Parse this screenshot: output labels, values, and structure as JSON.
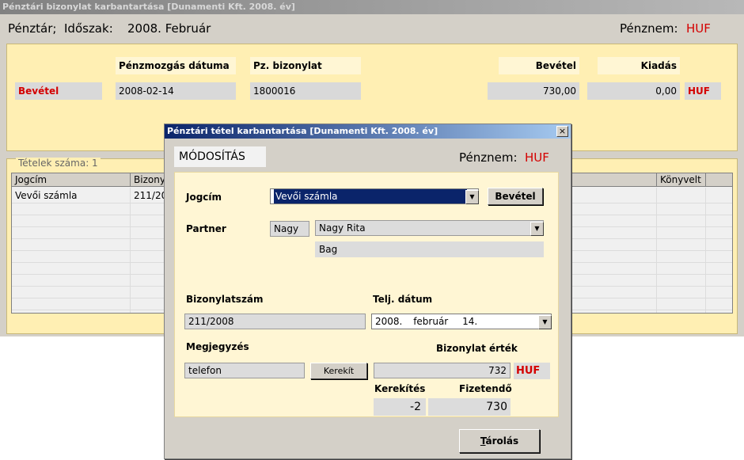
{
  "main": {
    "title": "Pénztári bizonylat karbantartása  [Dunamenti Kft.  2008. év]",
    "penztar_label": "Pénztár;",
    "idoszak_label": "Időszak:",
    "idoszak_value": "2008.  Február",
    "penznem_label": "Pénznem:",
    "penznem_value": "HUF",
    "cols": {
      "datum": "Pénzmozgás dátuma",
      "bizonylat": "Pz. bizonylat",
      "bevetel": "Bevétel",
      "kiadas": "Kiadás"
    },
    "row": {
      "type": "Bevétel",
      "datum": "2008-02-14",
      "bizonylat": "1800016",
      "bevetel": "730,00",
      "kiadas": "0,00",
      "currency": "HUF"
    },
    "grid": {
      "legend": "Tételek száma: 1",
      "headers": [
        "Jogcím",
        "Bizony",
        "Könyvelt"
      ],
      "rows": [
        [
          "Vevői számla",
          "211/20"
        ]
      ]
    }
  },
  "dialog": {
    "title": "Pénztári tétel karbantartása  [Dunamenti Kft.  2008. év]",
    "close": "×",
    "mode": "MÓDOSÍTÁS",
    "penznem_label": "Pénznem:",
    "penznem_value": "HUF",
    "jogcim_label": "Jogcím",
    "jogcim_value": "Vevői számla",
    "bevetel_button": "Bevétel",
    "partner_label": "Partner",
    "partner_code": "Nagy",
    "partner_name": "Nagy Rita",
    "partner_city": "Bag",
    "bizonylatszam_label": "Bizonylatszám",
    "bizonylatszam_value": "211/2008",
    "telj_label": "Telj. dátum",
    "telj_year": "2008.",
    "telj_month": "február",
    "telj_day": "14.",
    "megjegyzes_label": "Megjegyzés",
    "megjegyzes_value": "telefon",
    "kerekit_button": "Kerekít",
    "bizonylat_ertek_label": "Bizonylat érték",
    "bizonylat_ertek_value": "732",
    "bizonylat_ertek_currency": "HUF",
    "kerekites_label": "Kerekítés",
    "kerekites_value": "-2",
    "fizetendo_label": "Fizetendő",
    "fizetendo_value": "730",
    "store_button_hotkey": "T",
    "store_button_rest": "árolás"
  }
}
